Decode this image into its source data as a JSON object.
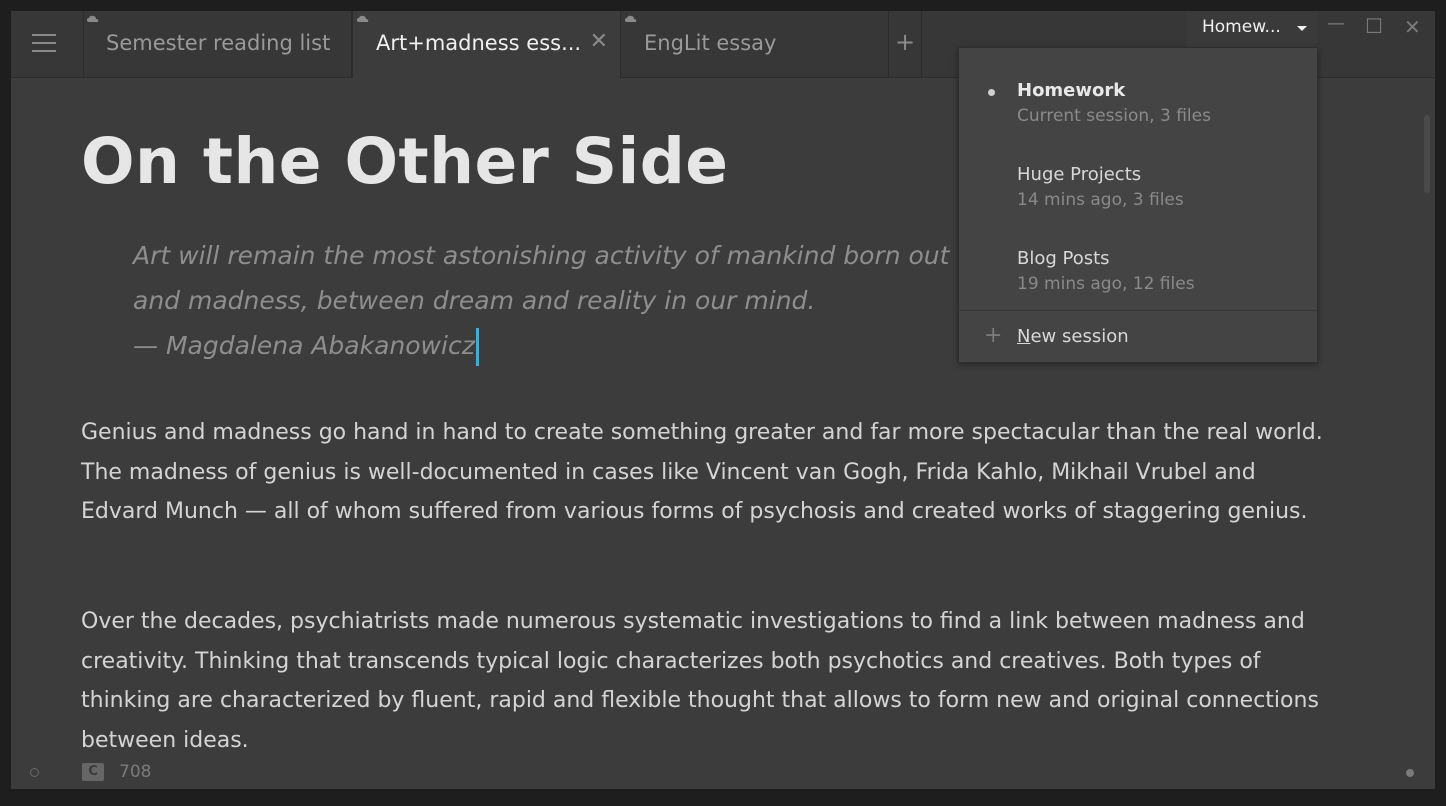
{
  "tabs": [
    {
      "label": "Semester reading list",
      "active": false
    },
    {
      "label": "Art+madness ess...",
      "active": true
    },
    {
      "label": "EngLit essay",
      "active": false
    }
  ],
  "new_tab_glyph": "+",
  "tab_close_glyph": "✕",
  "session_button": {
    "label": "Homew..."
  },
  "window_controls": {
    "minimize": "—",
    "maximize": "☐",
    "close": "✕"
  },
  "document": {
    "title": "On the Other Side",
    "quote": {
      "line1": "Art will remain the most astonishing activity of mankind born out o",
      "line2": "and madness, between dream and reality in our mind.",
      "line3": "— Magdalena Abakanowicz"
    },
    "paragraphs": [
      "Genius and madness go hand in hand to create something greater and far more spectacular than the real world. The madness of genius is well-documented in cases like Vincent van Gogh, Frida Kahlo, Mikhail Vrubel and Edvard Munch — all of whom suffered from various forms of psychosis and created works of staggering genius.",
      "Over the decades, psychiatrists made numerous systematic investigations to find a link between madness and creativity. Thinking that transcends typical logic characterizes both psychotics and creatives. Both types of thinking are characterized by fluent, rapid and flexible thought that allows to form new and original connections between ideas."
    ]
  },
  "sessions_menu": {
    "sessions": [
      {
        "name": "Homework",
        "meta": "Current session, 3 files",
        "current": true
      },
      {
        "name": "Huge Projects",
        "meta": "14 mins ago, 3 files",
        "current": false
      },
      {
        "name": "Blog Posts",
        "meta": "19 mins ago, 12 files",
        "current": false
      }
    ],
    "new_session": {
      "mnemonic": "N",
      "rest": "ew session",
      "glyph": "+"
    }
  },
  "status": {
    "mode_badge": "C",
    "word_count": "708"
  },
  "colors": {
    "accent_cursor": "#29b6e6",
    "background": "#3c3c3c"
  }
}
